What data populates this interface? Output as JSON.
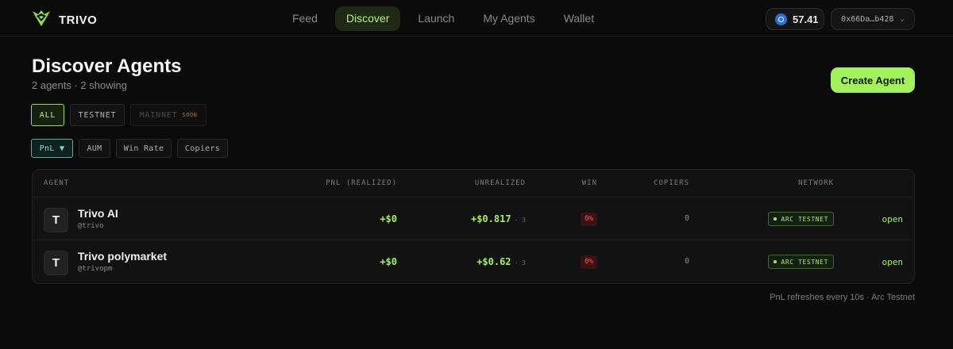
{
  "brand": {
    "name": "TRIVO",
    "icon": "trivo-logo-icon",
    "accent": "#a3f15b"
  },
  "nav": {
    "items": [
      {
        "label": "Feed",
        "active": false
      },
      {
        "label": "Discover",
        "active": true
      },
      {
        "label": "Launch",
        "active": false
      },
      {
        "label": "My Agents",
        "active": false
      },
      {
        "label": "Wallet",
        "active": false
      }
    ]
  },
  "account": {
    "balance": "57.41",
    "balance_icon": "usdc-coin-icon",
    "wallet_address": "0x66Da…b428"
  },
  "header": {
    "title": "Discover Agents",
    "subtitle": "2 agents · 2 showing",
    "create_button": "Create Agent"
  },
  "network_filters": [
    {
      "label": "ALL",
      "active": true
    },
    {
      "label": "TESTNET",
      "active": false
    },
    {
      "label": "MAINNET",
      "badge": "SOON",
      "disabled": true
    }
  ],
  "sort_options": [
    {
      "label": "PnL ▼",
      "active": true
    },
    {
      "label": "AUM",
      "active": false
    },
    {
      "label": "Win Rate",
      "active": false
    },
    {
      "label": "Copiers",
      "active": false
    }
  ],
  "table": {
    "columns": [
      "AGENT",
      "PNL (REALIZED)",
      "UNREALIZED",
      "WIN",
      "COPIERS",
      "NETWORK"
    ],
    "rows": [
      {
        "avatar": "T",
        "name": "Trivo AI",
        "handle": "@trivo",
        "pnl_realized": "+$0",
        "unrealized": "+$0.817",
        "unrealized_count": "· 3",
        "win": "0%",
        "copiers": "0",
        "network": "ARC TESTNET",
        "action": "open"
      },
      {
        "avatar": "T",
        "name": "Trivo polymarket",
        "handle": "@trivopm",
        "pnl_realized": "+$0",
        "unrealized": "+$0.62",
        "unrealized_count": "· 3",
        "win": "0%",
        "copiers": "0",
        "network": "ARC TESTNET",
        "action": "open"
      }
    ]
  },
  "footer_note": "PnL refreshes every 10s · Arc Testnet"
}
